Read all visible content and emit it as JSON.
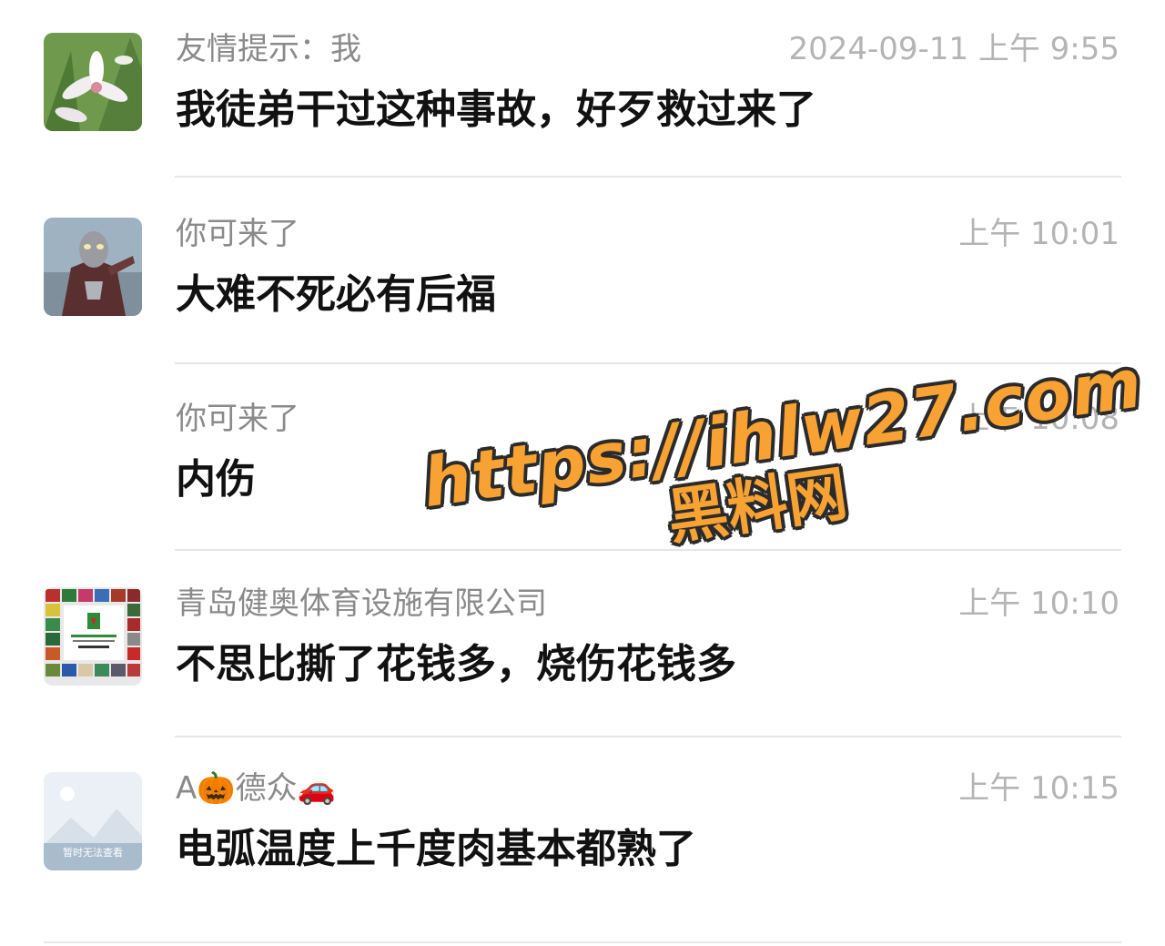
{
  "comments": [
    {
      "name": "友情提示：我",
      "time": "2024-09-11 上午 9:55",
      "message": "我徒弟干过这种事故，好歹救过来了",
      "avatar": "orchid-photo-avatar"
    },
    {
      "name": "你可来了",
      "time": "上午 10:01",
      "message": "大难不死必有后福",
      "avatar": "hero-figure-avatar"
    },
    {
      "name": "你可来了",
      "time": "上午 10:08",
      "message": "内伤",
      "avatar": ""
    },
    {
      "name": "青岛健奥体育设施有限公司",
      "time": "上午 10:10",
      "message": "不思比撕了花钱多，烧伤花钱多",
      "avatar": "color-grid-avatar"
    },
    {
      "name_prefix": "A",
      "name_middle": "德众",
      "time": "上午 10:15",
      "message": "电弧温度上千度肉基本都熟了",
      "avatar": "placeholder-avatar",
      "avatar_caption": "暂时无法查看"
    }
  ],
  "watermark": {
    "line1": "https://ihlw27.com",
    "line2": "黑料网"
  },
  "colors": {
    "name": "#8a8a8a",
    "time": "#b4b4b4",
    "message": "#111111",
    "divider": "#e6e6e6",
    "watermark_fill": "#f7a233"
  }
}
